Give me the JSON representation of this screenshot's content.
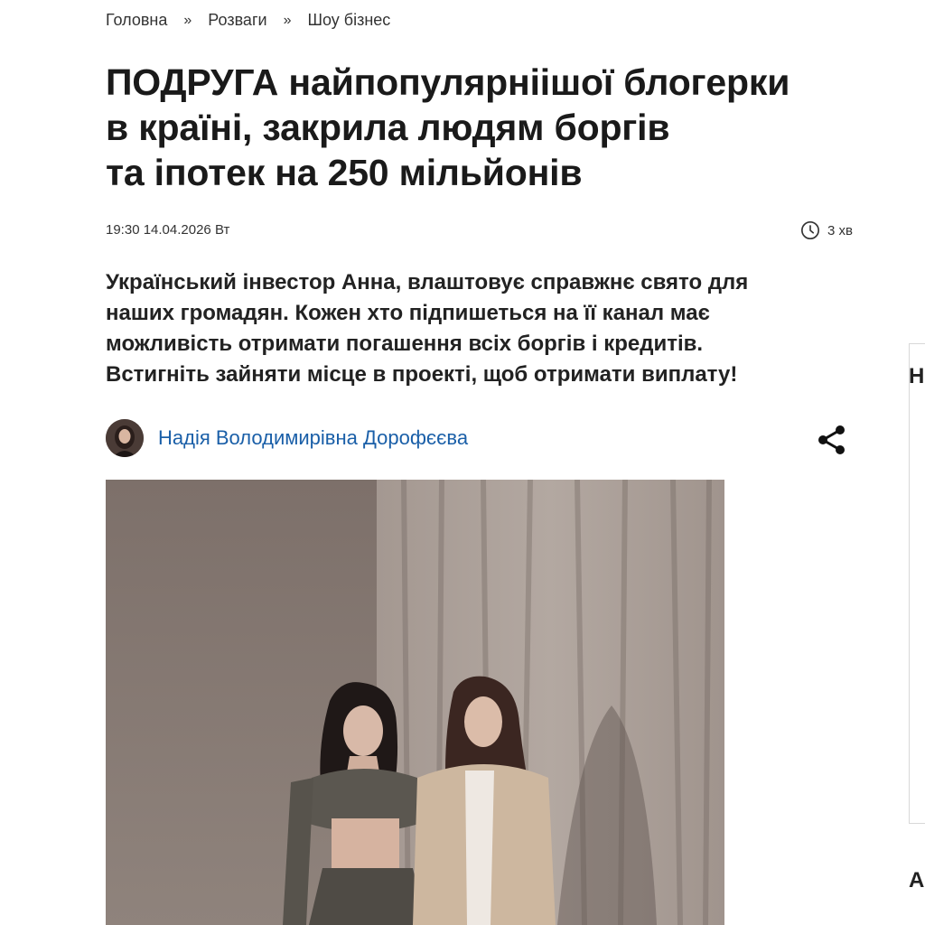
{
  "breadcrumb": {
    "items": [
      "Головна",
      "Розваги",
      "Шоу бізнес"
    ],
    "separator": "»"
  },
  "article": {
    "title_lines": [
      "ПОДРУГА найпопулярніішої блогерки",
      "в країні, закрила людям боргів",
      "та іпотек на 250 мільйонів"
    ],
    "datetime": "19:30 14.04.2026 Вт",
    "read_time": "3 хв",
    "lead_lines": [
      "Український інвестор Анна, влаштовує справжнє свято для",
      "наших громадян. Кожен хто підпишеться на її канал має",
      "можливість отримати погашення всіх боргів і кредитів.",
      "Встигніть зайняти місце в проекті, щоб отримати виплату!"
    ],
    "author": "Надія Володимирівна Дорофєєва"
  },
  "sidebar": {
    "letter_top": "Н",
    "letter_bottom": "А"
  },
  "icons": {
    "read_time": "clock-icon",
    "share": "share-icon"
  },
  "colors": {
    "author_link": "#1a5fa8",
    "text": "#1c1c1c"
  }
}
